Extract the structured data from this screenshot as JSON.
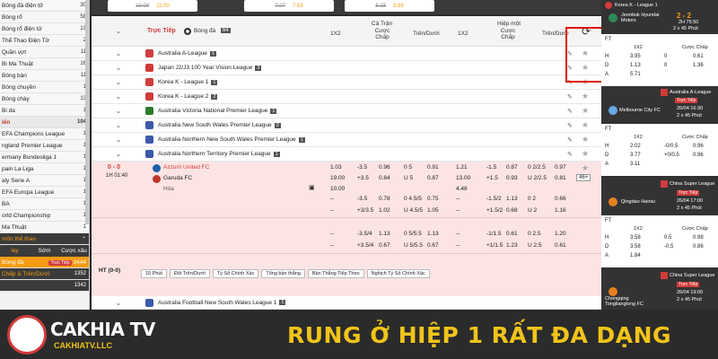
{
  "sidebar": {
    "items": [
      {
        "label": "Bóng đá điện tử",
        "count": "30"
      },
      {
        "label": "Bóng rổ",
        "count": "58"
      },
      {
        "label": "Bóng rổ điện tử",
        "count": "13"
      },
      {
        "label": "Thể Thao Điện Tử",
        "count": "2"
      },
      {
        "label": "Quần vợt",
        "count": "11"
      },
      {
        "label": "Bi Ma Thuật",
        "count": "16"
      },
      {
        "label": "Bóng bàn",
        "count": "11"
      },
      {
        "label": "Bóng chuyền",
        "count": "1"
      },
      {
        "label": "Bóng chày",
        "count": "13"
      },
      {
        "label": "Bi da",
        "count": "1"
      }
    ],
    "section_label": "iển",
    "section_count": "104",
    "leagues": [
      {
        "label": "EFA Champions League",
        "count": "1"
      },
      {
        "label": "ngland Premier League",
        "count": "1"
      },
      {
        "label": "ermany Bundesliga 1",
        "count": "1"
      },
      {
        "label": "pain La Liga",
        "count": "1"
      },
      {
        "label": "aly Serie A",
        "count": "1"
      },
      {
        "label": "EFA Europa League",
        "count": "1"
      },
      {
        "label": "BA",
        "count": "1"
      },
      {
        "label": "orld Championship",
        "count": "1"
      },
      {
        "label": "Ma Thuật",
        "count": "1"
      }
    ],
    "section2": "môn thể thao",
    "tabs": [
      "lay",
      "Sớm",
      "Cược xâu"
    ],
    "bottom_items": [
      {
        "label": "Bóng đá",
        "badge": "Trực Tiếp",
        "count": "3444"
      },
      {
        "label": "Chấp & Trên/Dưới",
        "count": "1352"
      },
      {
        "label": "",
        "count": "1342"
      }
    ]
  },
  "topbar": {
    "odds": [
      {
        "old": "10.00",
        "new": "11.00"
      },
      {
        "old": "7.07",
        "new": "7.63"
      },
      {
        "old": "8.23",
        "new": "8.88"
      }
    ]
  },
  "header": {
    "live": "Trực Tiếp",
    "sport": "Bóng đá",
    "count": "64",
    "full_match": "Cả Trận",
    "first_half": "Hiệp một",
    "col_1x2": "1X2",
    "col_handicap": "Cược Chấp",
    "col_ou": "Trên/Dưới",
    "col_1x2b": "1X2",
    "col_handicap2": "Cược Chấp",
    "col_ou2": "Trên/Dưới"
  },
  "leagues": [
    {
      "name": "Australia A-League",
      "count": "1",
      "color": "#d13b3b"
    },
    {
      "name": "Japan J2/J3 100 Year Vision League",
      "count": "3",
      "color": "#d13b3b"
    },
    {
      "name": "Korea K - League 1",
      "count": "1",
      "color": "#d13b3b"
    },
    {
      "name": "Korea K - League 2",
      "count": "2",
      "color": "#d13b3b"
    },
    {
      "name": "Australia Victoria National Premier League",
      "count": "1",
      "color": "#2c7a2c"
    },
    {
      "name": "Australia New South Wales Premier League",
      "count": "3",
      "color": "#3a5aa8"
    },
    {
      "name": "Australia Northern New South Wales Premier League",
      "count": "1",
      "color": "#3a5aa8"
    },
    {
      "name": "Australia Northern Territory Premier League",
      "count": "1",
      "color": "#3a5aa8"
    }
  ],
  "match": {
    "score": "0 - 0",
    "time": "1H 01:40",
    "home": "Azzurri United FC",
    "away": "Garuda FC",
    "draw": "Hòa",
    "more": "46+",
    "rows": [
      [
        "1.03",
        "-3.5",
        "0.96",
        "0 5",
        "0.91",
        "1.21",
        "-1.5",
        "0.87",
        "0 2/2.5",
        "0.97"
      ],
      [
        "19.00",
        "+3.5",
        "0.84",
        "U 5",
        "0.87",
        "13.00",
        "+1.5",
        "0.93",
        "U 2/2.5",
        "0.81"
      ],
      [
        "10.00",
        "",
        "",
        "",
        "",
        "4.48",
        "",
        "",
        "",
        ""
      ],
      [
        "--",
        "-3.5",
        "0.78",
        "0 4.5/5",
        "0.75",
        "--",
        "-1.5/2",
        "1.13",
        "0 2",
        "0.66"
      ],
      [
        "--",
        "+3/3.5",
        "1.02",
        "U 4.5/5",
        "1.05",
        "--",
        "+1.5/2",
        "0.68",
        "U 2",
        "1.16"
      ],
      [
        "--",
        "-3.5/4",
        "1.13",
        "0 5/5.5",
        "1.13",
        "--",
        "-1/1.5",
        "0.61",
        "0 2.5",
        "1.20"
      ],
      [
        "--",
        "+3.5/4",
        "0.67",
        "U 5/5.5",
        "0.67",
        "--",
        "+1/1.5",
        "1.23",
        "U 2.5",
        "0.61"
      ]
    ]
  },
  "ht_label": "HT (0-0)",
  "filters": [
    "15 Phút",
    "Đội Trên/Dưới",
    "Tỷ Số Chính Xác",
    "Tổng bàn thắng",
    "Bàn Thắng Tiếp Theo",
    "Nghịch Tỷ Số Chính Xác"
  ],
  "next_league": {
    "name": "Australia Football New South Wales League 1",
    "count": "1"
  },
  "right": {
    "card1": {
      "title": "Korea K - League 1",
      "team": "Jeonbuk Hyundai Motors",
      "score": "2 - 2",
      "time": "2H 75:50",
      "duration": "2 x 45 Phút"
    },
    "ft": "FT",
    "col_1x2": "1X2",
    "col_hc": "Cược Chấp",
    "rows1": [
      {
        "label": "H",
        "v1": "3.95",
        "v2": "0",
        "v3": "0.61"
      },
      {
        "label": "D",
        "v1": "1.13",
        "v2": "0",
        "v3": "1.36"
      },
      {
        "label": "A",
        "v1": "5.71",
        "v2": "",
        "v3": ""
      }
    ],
    "card2": {
      "title": "Australia A-League",
      "live": "Trực Tiếp",
      "team": "Melbourne City FC",
      "date": "26/04 16:30",
      "duration": "2 x 45 Phút"
    },
    "rows2": [
      {
        "label": "H",
        "v1": "2.02",
        "v2": "-0/0.5",
        "v3": "0.96"
      },
      {
        "label": "D",
        "v1": "3.77",
        "v2": "+0/0.5",
        "v3": "0.96"
      },
      {
        "label": "A",
        "v1": "3.11",
        "v2": "",
        "v3": ""
      }
    ],
    "card3": {
      "title": "China Super League",
      "live": "Trực Tiếp",
      "team": "Qingdao Hainiu",
      "date": "26/04 17:00",
      "duration": "2 x 45 Phút"
    },
    "rows3": [
      {
        "label": "H",
        "v1": "3.58",
        "v2": "0.5",
        "v3": "0.98"
      },
      {
        "label": "D",
        "v1": "3.58",
        "v2": "-0.5",
        "v3": "0.86"
      },
      {
        "label": "A",
        "v1": "1.84",
        "v2": "",
        "v3": ""
      }
    ],
    "card4": {
      "title": "China Super League",
      "live": "Trực Tiếp",
      "team": "Chongqing Tonglianglong FC",
      "date": "26/04 19:00",
      "duration": "2 x 45 Phút"
    }
  },
  "banner": {
    "brand": "CAKHIA TV",
    "site": "CAKHIATV.LLC",
    "slogan": "RUNG Ở HIỆP 1 RẤT ĐA DẠNG",
    "accent": "#f0c419"
  }
}
